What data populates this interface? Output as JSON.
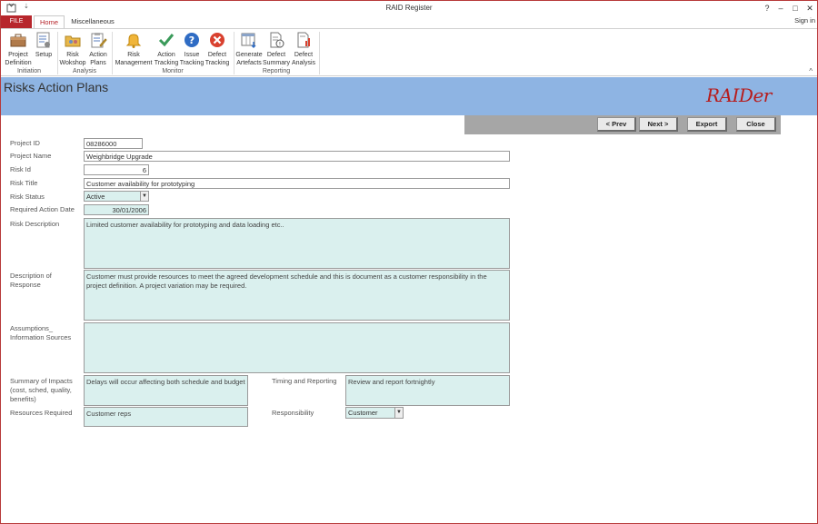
{
  "window": {
    "title": "RAID Register",
    "help": "?",
    "minimize": "–",
    "maximize": "□",
    "close": "✕"
  },
  "tabs": {
    "file": "FILE",
    "home": "Home",
    "misc": "Miscellaneous",
    "sign_in": "Sign in"
  },
  "ribbon": {
    "groups": {
      "initiation": "Initiation",
      "analysis": "Analysis",
      "monitor": "Monitor",
      "reporting": "Reporting"
    },
    "buttons": {
      "project_definition": [
        "Project",
        "Definition"
      ],
      "setup": [
        "Setup",
        ""
      ],
      "risk_workshop": [
        "Risk",
        "Wokshop"
      ],
      "action_plans": [
        "Action",
        "Plans"
      ],
      "risk_management": [
        "Risk",
        "Management"
      ],
      "action_tracking": [
        "Action",
        "Tracking"
      ],
      "issue_tracking": [
        "Issue",
        "Tracking"
      ],
      "defect_tracking": [
        "Defect",
        "Tracking"
      ],
      "generate_artefacts": [
        "Generate",
        "Artefacts"
      ],
      "defect_summary": [
        "Defect",
        "Summary"
      ],
      "defect_analysis": [
        "Defect",
        "Analysis"
      ]
    },
    "collapse": "^"
  },
  "header": {
    "title": "Risks Action Plans",
    "brand": "RAIDer"
  },
  "nav": {
    "prev": "< Prev",
    "next": "Next >",
    "export": "Export",
    "close": "Close"
  },
  "form": {
    "project_id": {
      "label": "Project ID",
      "value": "08286000"
    },
    "project_name": {
      "label": "Project Name",
      "value": "Weighbridge Upgrade"
    },
    "risk_id": {
      "label": "Risk Id",
      "value": "6"
    },
    "risk_title": {
      "label": "Risk Title",
      "value": "Customer availability for prototyping"
    },
    "risk_status": {
      "label": "Risk Status",
      "value": "Active"
    },
    "required_action_date": {
      "label": "Required Action Date",
      "value": "30/01/2006"
    },
    "risk_description": {
      "label": "Risk Description",
      "value": "Limited customer availability for prototyping and data loading etc.."
    },
    "description_of_response": {
      "label": [
        "Description of",
        "Response"
      ],
      "value": "Customer must provide resources to meet the agreed development schedule and this is document as a customer responsibility in the project definition. A project variation may be required."
    },
    "assumptions": {
      "label": [
        "Assumptions_",
        "Information Sources"
      ],
      "value": ""
    },
    "summary_of_impacts": {
      "label": [
        "Summary of Impacts",
        "(cost, sched, quality,",
        "benefits)"
      ],
      "value": "Delays will occur affecting both schedule and budget"
    },
    "timing_and_reporting": {
      "label": "Timing and Reporting",
      "value": "Review and report fortnightly"
    },
    "resources_required": {
      "label": "Resources Required",
      "value": "Customer reps"
    },
    "responsibility": {
      "label": "Responsibility",
      "value": "Customer"
    }
  },
  "colors": {
    "file_tab": "#b7262c",
    "header_band": "#8eb4e3",
    "brand": "#b71c1c",
    "memo_bg": "#daf0ee",
    "nav_strip": "#a6a6a6"
  },
  "icons": {
    "app": "access-app-icon",
    "project_definition": "briefcase-icon",
    "setup": "checklist-gear-icon",
    "risk_workshop": "folder-people-icon",
    "action_plans": "clipboard-pencil-icon",
    "risk_management": "bell-icon",
    "action_tracking": "checkmark-icon",
    "issue_tracking": "question-icon",
    "defect_tracking": "cross-circle-icon",
    "generate_artefacts": "table-download-icon",
    "defect_summary": "document-info-icon",
    "defect_analysis": "document-chart-icon"
  }
}
